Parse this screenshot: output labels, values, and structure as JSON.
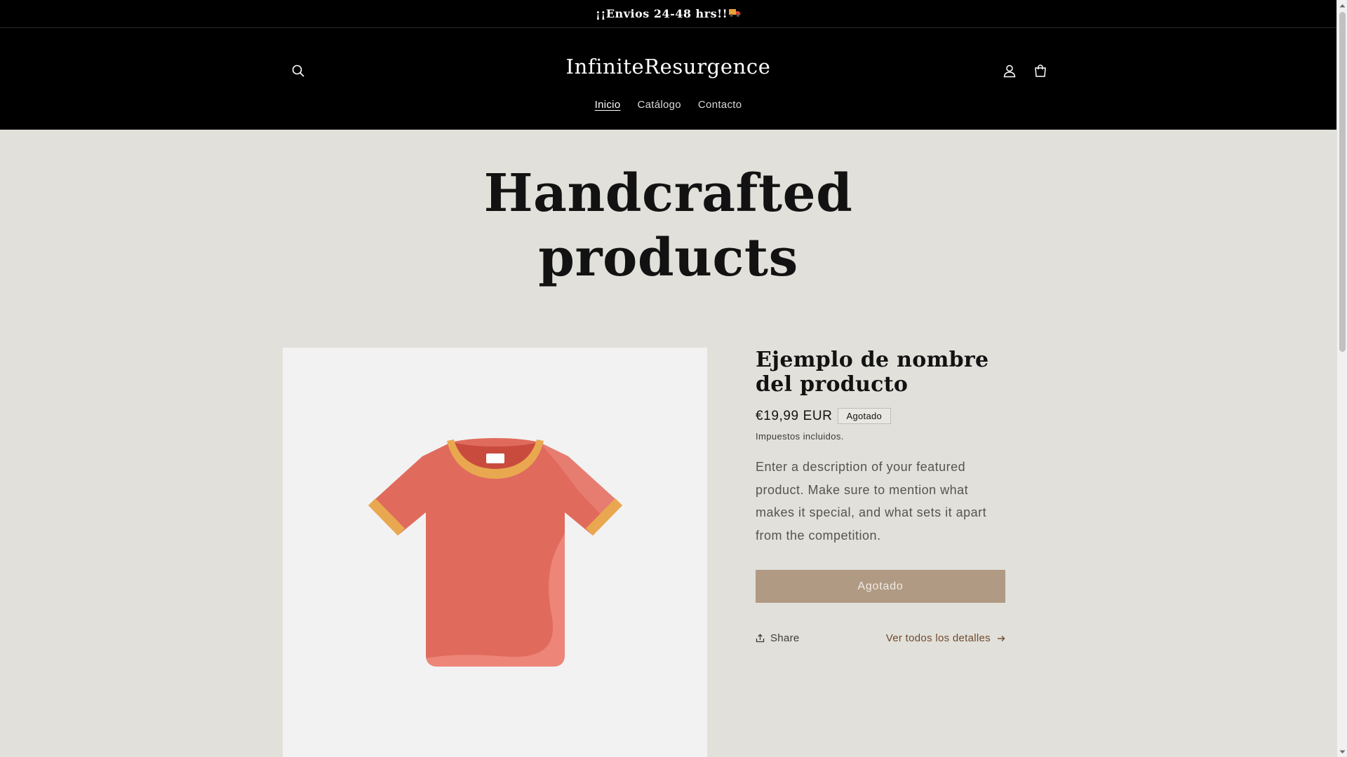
{
  "announcement": {
    "text": "¡¡Envios 24-48 hrs!!"
  },
  "header": {
    "logo": "InfiniteResurgence",
    "nav": [
      {
        "label": "Inicio",
        "active": true
      },
      {
        "label": "Catálogo",
        "active": false
      },
      {
        "label": "Contacto",
        "active": false
      }
    ],
    "icons": [
      "search-icon",
      "account-icon",
      "cart-icon"
    ]
  },
  "hero": {
    "line1": "Handcrafted",
    "line2": "products"
  },
  "product": {
    "title": "Ejemplo de nombre del producto",
    "price": "€19,99 EUR",
    "badge": "Agotado",
    "tax_note": "Impuestos incluidos.",
    "description": "Enter a description of your featured product. Make sure to mention what makes it special, and what sets it apart from the competition.",
    "button_label": "Agotado",
    "share_label": "Share",
    "details_label": "Ver todos los detalles"
  },
  "colors": {
    "background": "#e1e0da",
    "header": "#000000",
    "button": "#b09a84",
    "link": "#6f4a2c",
    "tshirt": "#e06b5d",
    "tshirt_trim": "#e9a84f"
  }
}
